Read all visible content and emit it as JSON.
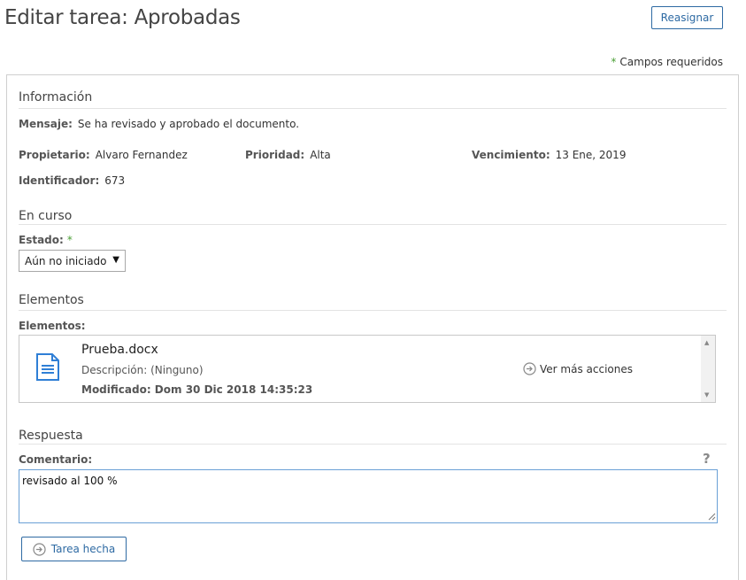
{
  "page": {
    "title": "Editar tarea: Aprobadas",
    "reassign_label": "Reasignar",
    "required_star": "*",
    "required_note": "Campos requeridos"
  },
  "info": {
    "section_title": "Información",
    "message_label": "Mensaje:",
    "message_value": "Se ha revisado y aprobado el documento.",
    "owner_label": "Propietario:",
    "owner_value": "Alvaro Fernandez",
    "priority_label": "Prioridad:",
    "priority_value": "Alta",
    "due_label": "Vencimiento:",
    "due_value": "13 Ene, 2019",
    "id_label": "Identificador:",
    "id_value": "673"
  },
  "progress": {
    "section_title": "En curso",
    "state_label": "Estado:",
    "required_star": "*",
    "state_value": "Aún no iniciado"
  },
  "elements": {
    "section_title": "Elementos",
    "list_label": "Elementos:",
    "items": [
      {
        "name": "Prueba.docx",
        "description": "Descripción: (Ninguno)",
        "modified": "Modificado: Dom 30 Dic 2018 14:35:23",
        "actions_label": "Ver más acciones",
        "icon": "document-icon"
      }
    ]
  },
  "response": {
    "section_title": "Respuesta",
    "comment_label": "Comentario:",
    "help_glyph": "?",
    "comment_value": "revisado al 100 %",
    "done_label": "Tarea hecha"
  },
  "colors": {
    "accent": "#2e6aa3",
    "required": "#4a9f34",
    "doc_icon": "#2f7fd6"
  }
}
